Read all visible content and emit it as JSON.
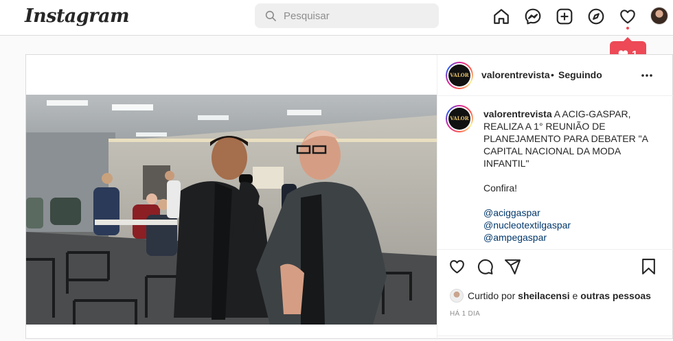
{
  "header": {
    "logo": "Instagram",
    "search_placeholder": "Pesquisar",
    "nav_icons": [
      "home-icon",
      "messenger-icon",
      "new-post-icon",
      "explore-icon",
      "activity-heart-icon",
      "profile-avatar"
    ],
    "notification": {
      "count": "1",
      "color": "#ed4956"
    }
  },
  "post": {
    "author": "valorentrevista",
    "separator": "•",
    "follow_label": "Seguindo",
    "avatar_label": "VALOR",
    "caption": {
      "username": "valorentrevista",
      "text": "A ACIG-GASPAR, REALIZA A 1° REUNIÃO DE PLANEJAMENTO PARA DEBATER \"A CAPITAL NACIONAL DA MODA INFANTIL\"",
      "cta": "Confira!",
      "mentions": [
        "@aciggaspar",
        "@nucleotextilgaspar",
        "@ampegaspar"
      ]
    },
    "likes": {
      "prefix": "Curtido por",
      "user": "sheilacensi",
      "connector": "e",
      "others": "outras pessoas"
    },
    "timestamp": "HÁ 1 DIA"
  }
}
